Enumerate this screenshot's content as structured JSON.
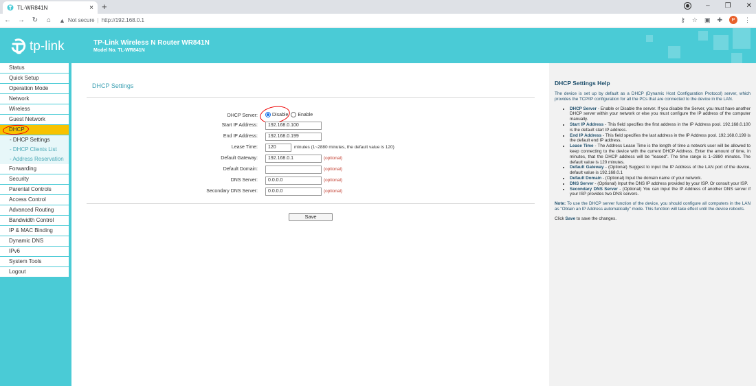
{
  "browser": {
    "tab_title": "TL-WR841N",
    "tab_close": "×",
    "new_tab": "+",
    "security_label": "Not secure",
    "url": "http://192.168.0.1",
    "profile_initial": "P"
  },
  "header": {
    "logo_text": "tp-link",
    "title": "TP-Link Wireless N Router WR841N",
    "model": "Model No. TL-WR841N"
  },
  "menu": [
    {
      "label": "Status"
    },
    {
      "label": "Quick Setup"
    },
    {
      "label": "Operation Mode"
    },
    {
      "label": "Network"
    },
    {
      "label": "Wireless"
    },
    {
      "label": "Guest Network"
    },
    {
      "label": "DHCP",
      "active": true
    },
    {
      "label": "Forwarding"
    },
    {
      "label": "Security"
    },
    {
      "label": "Parental Controls"
    },
    {
      "label": "Access Control"
    },
    {
      "label": "Advanced Routing"
    },
    {
      "label": "Bandwidth Control"
    },
    {
      "label": "IP & MAC Binding"
    },
    {
      "label": "Dynamic DNS"
    },
    {
      "label": "IPv6"
    },
    {
      "label": "System Tools"
    },
    {
      "label": "Logout"
    }
  ],
  "submenu": [
    {
      "label": "- DHCP Settings"
    },
    {
      "label": "- DHCP Clients List"
    },
    {
      "label": "- Address Reservation"
    }
  ],
  "form": {
    "section_title": "DHCP Settings",
    "dhcp_server_label": "DHCP Server:",
    "disable_label": "Disable",
    "enable_label": "Enable",
    "dhcp_server_value": "Disable",
    "start_ip_label": "Start IP Address:",
    "start_ip": "192.168.0.100",
    "end_ip_label": "End IP Address:",
    "end_ip": "192.168.0.199",
    "lease_label": "Lease Time:",
    "lease": "120",
    "lease_hint": "minutes (1~2880 minutes, the default value is 120)",
    "gateway_label": "Default Gateway:",
    "gateway": "192.168.0.1",
    "domain_label": "Default Domain:",
    "domain": "",
    "dns_label": "DNS Server:",
    "dns": "0.0.0.0",
    "dns2_label": "Secondary DNS Server:",
    "dns2": "0.0.0.0",
    "optional": "(optional)",
    "save_label": "Save"
  },
  "help": {
    "title": "DHCP Settings Help",
    "intro": "The device is set up by default as a DHCP (Dynamic Host Configuration Protocol) server, which provides the TCP/IP configuration for all the PCs that are connected to the device in the LAN.",
    "items": [
      {
        "key": "DHCP Server",
        "text": " - Enable or Disable the server. If you disable the Server, you must have another DHCP server within your network or else you must configure the IP address of the computer manually."
      },
      {
        "key": "Start IP Address",
        "text": " - This field specifies the first address in the IP Address pool. 192.168.0.100 is the default start IP address."
      },
      {
        "key": "End IP Address",
        "text": " - This field specifies the last address in the IP Address pool. 192.168.0.199 is the default end IP address."
      },
      {
        "key": "Lease Time",
        "text": " - The Address Lease Time is the length of time a network user will be allowed to keep connecting to the device with the current DHCP Address. Enter the amount of time, in minutes, that the DHCP address will be \"leased\". The time range is 1~2880 minutes. The default value is 120 minutes."
      },
      {
        "key": "Default Gateway",
        "text": " - (Optional) Suggest to input the IP Address of the LAN port of the device, default value is 192.168.0.1"
      },
      {
        "key": "Default Domain",
        "text": " - (Optional) Input the domain name of your network."
      },
      {
        "key": "DNS Server",
        "text": " - (Optional) Input the DNS IP address provided by your ISP. Or consult your ISP."
      },
      {
        "key": "Secondary DNS Server",
        "text": " - (Optional) You can input the IP Address of another DNS server if your ISP provides two DNS servers."
      }
    ],
    "note_label": "Note:",
    "note_text": " To use the DHCP server function of the device, you should configure all computers in the LAN as \"Obtain an IP Address automatically\" mode. This function will take effect until the device reboots.",
    "click_prefix": "Click ",
    "click_keyword": "Save",
    "click_suffix": " to save the changes."
  },
  "colors": {
    "brand": "#4acbd6",
    "active_menu": "#f7c200",
    "section_title": "#3a9fb2",
    "optional": "#c0392b",
    "annotation": "#e00000"
  },
  "icons": [
    "tplink-favicon-icon",
    "back-icon",
    "forward-icon",
    "reload-icon",
    "home-icon",
    "warning-icon",
    "key-icon",
    "star-icon",
    "extension-icon",
    "puzzle-icon",
    "menu-dots-icon",
    "record-icon",
    "minimize-icon",
    "maximize-icon",
    "close-icon",
    "tplink-logo-icon"
  ]
}
